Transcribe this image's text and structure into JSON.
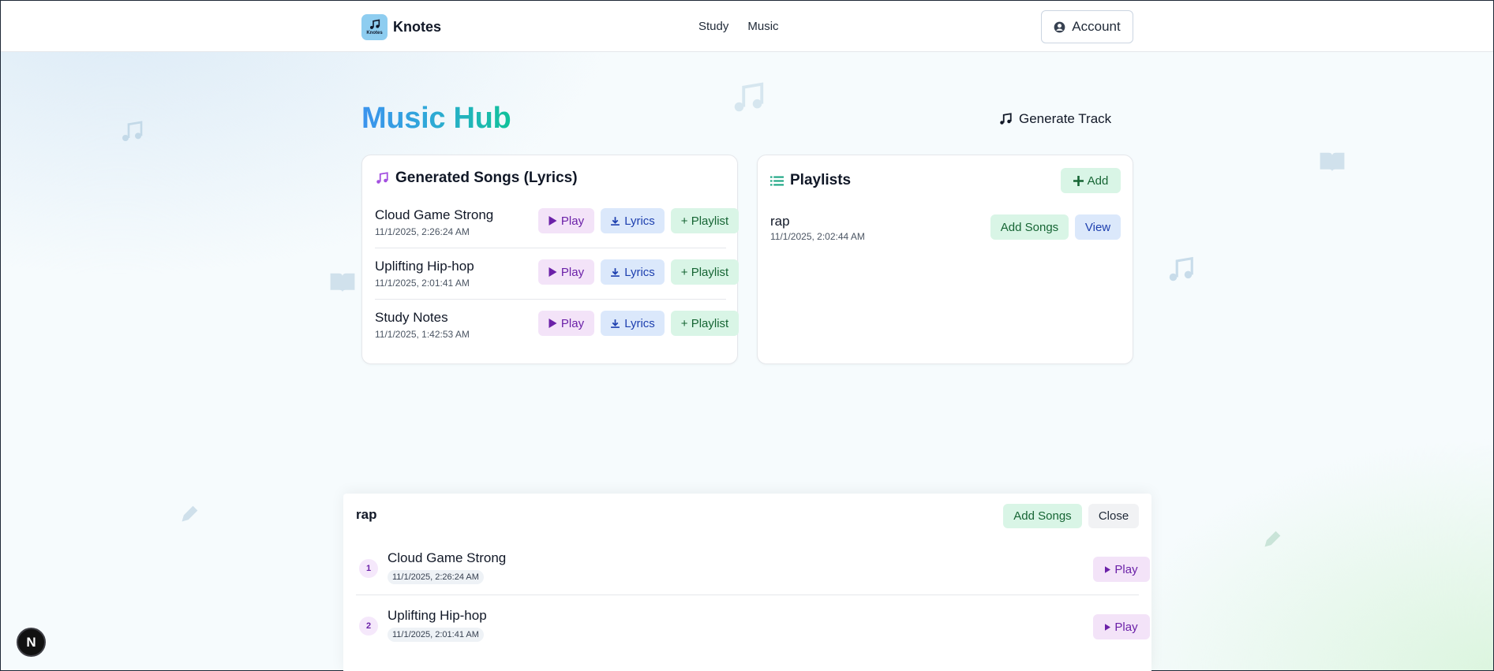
{
  "header": {
    "brand": "Knotes",
    "logo_caption": "Knotes",
    "nav": [
      {
        "label": "Study"
      },
      {
        "label": "Music"
      }
    ],
    "account_label": "Account"
  },
  "page": {
    "title": "Music Hub",
    "generate_track_label": "Generate Track"
  },
  "songs_card": {
    "title": "Generated Songs (Lyrics)",
    "play_label": "Play",
    "lyrics_label": "Lyrics",
    "playlist_label": "+ Playlist",
    "songs": [
      {
        "name": "Cloud Game Strong",
        "date": "11/1/2025, 2:26:24 AM"
      },
      {
        "name": "Uplifting Hip-hop",
        "date": "11/1/2025, 2:01:41 AM"
      },
      {
        "name": "Study Notes",
        "date": "11/1/2025, 1:42:53 AM"
      }
    ]
  },
  "playlists_card": {
    "title": "Playlists",
    "add_label": "Add",
    "add_songs_label": "Add Songs",
    "view_label": "View",
    "playlists": [
      {
        "name": "rap",
        "date": "11/1/2025, 2:02:44 AM"
      }
    ]
  },
  "panel": {
    "title": "rap",
    "add_songs_label": "Add Songs",
    "close_label": "Close",
    "play_label": "Play",
    "tracks": [
      {
        "num": "1",
        "name": "Cloud Game Strong",
        "date": "11/1/2025, 2:26:24 AM"
      },
      {
        "num": "2",
        "name": "Uplifting Hip-hop",
        "date": "11/1/2025, 2:01:41 AM"
      }
    ]
  },
  "dev_badge": "N",
  "colors": {
    "play_bg": "#f3e3f8",
    "lyrics_bg": "#dbe8fb",
    "playlist_bg": "#d9f5e6",
    "accent_blue": "#3b93ee",
    "accent_green": "#11c29a"
  }
}
